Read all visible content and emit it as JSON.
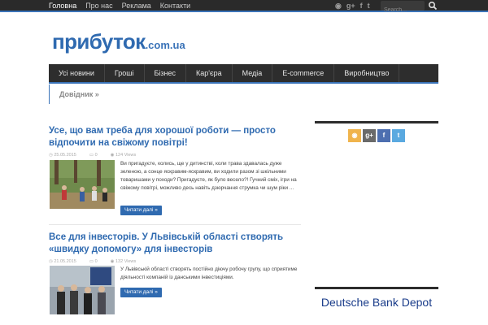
{
  "top_nav": {
    "items": [
      "Головна",
      "Про нас",
      "Реклама",
      "Контакти"
    ],
    "social": [
      "rss-icon",
      "google-plus-icon",
      "facebook-icon",
      "twitter-icon"
    ],
    "social_glyphs": [
      "◉",
      "g+",
      "f",
      "t"
    ],
    "search_placeholder": "Search..."
  },
  "logo": {
    "main": "прибуток",
    "domain": ".com.ua"
  },
  "main_nav": {
    "items": [
      "Усі новини",
      "Гроші",
      "Бізнес",
      "Кар'єра",
      "Медіа",
      "E-commerce",
      "Виробництво"
    ],
    "sub_item": "Довідник »"
  },
  "posts": [
    {
      "title": "Усе, що вам треба для хорошої роботи — просто відпочити на свіжому повітрі!",
      "date": "25.05.2015",
      "comments": "0",
      "views": "124 Views",
      "excerpt": "Ви пригадуєте, колись, ще у дитинстві, коли трава здавалась дуже зеленою, а сонце яскравим-яскравим, ви ходили разом зі шкільними товаришами у походи? Пригадуєте, як було весело?! Гучний сміх, ігри на свіжому повітрі, можливо десь навіть дзюрчання струмка чи шум ріки ...",
      "more": "Читати далі »"
    },
    {
      "title": "Все для інвесторів. У Львівській області створять «швидку допомогу» для інвесторів",
      "date": "21.05.2015",
      "comments": "0",
      "views": "132 Views",
      "excerpt": "У Львівській області створять постійно діючу робочу групу, що сприятиме діяльності компаній із данськими інвестиціями.",
      "more": "Читати далі »"
    }
  ],
  "sidebar": {
    "social": [
      "rss-icon",
      "google-plus-icon",
      "facebook-icon",
      "twitter-icon"
    ],
    "social_glyphs": [
      "◉",
      "g+",
      "f",
      "t"
    ],
    "ad_text": "Deutsche Bank Depot"
  },
  "colors": {
    "accent": "#2f6ab0",
    "rss": "#f0b44c",
    "google_plus": "#6a6a6a",
    "facebook": "#4d6fb0",
    "twitter": "#5aa9e0"
  }
}
